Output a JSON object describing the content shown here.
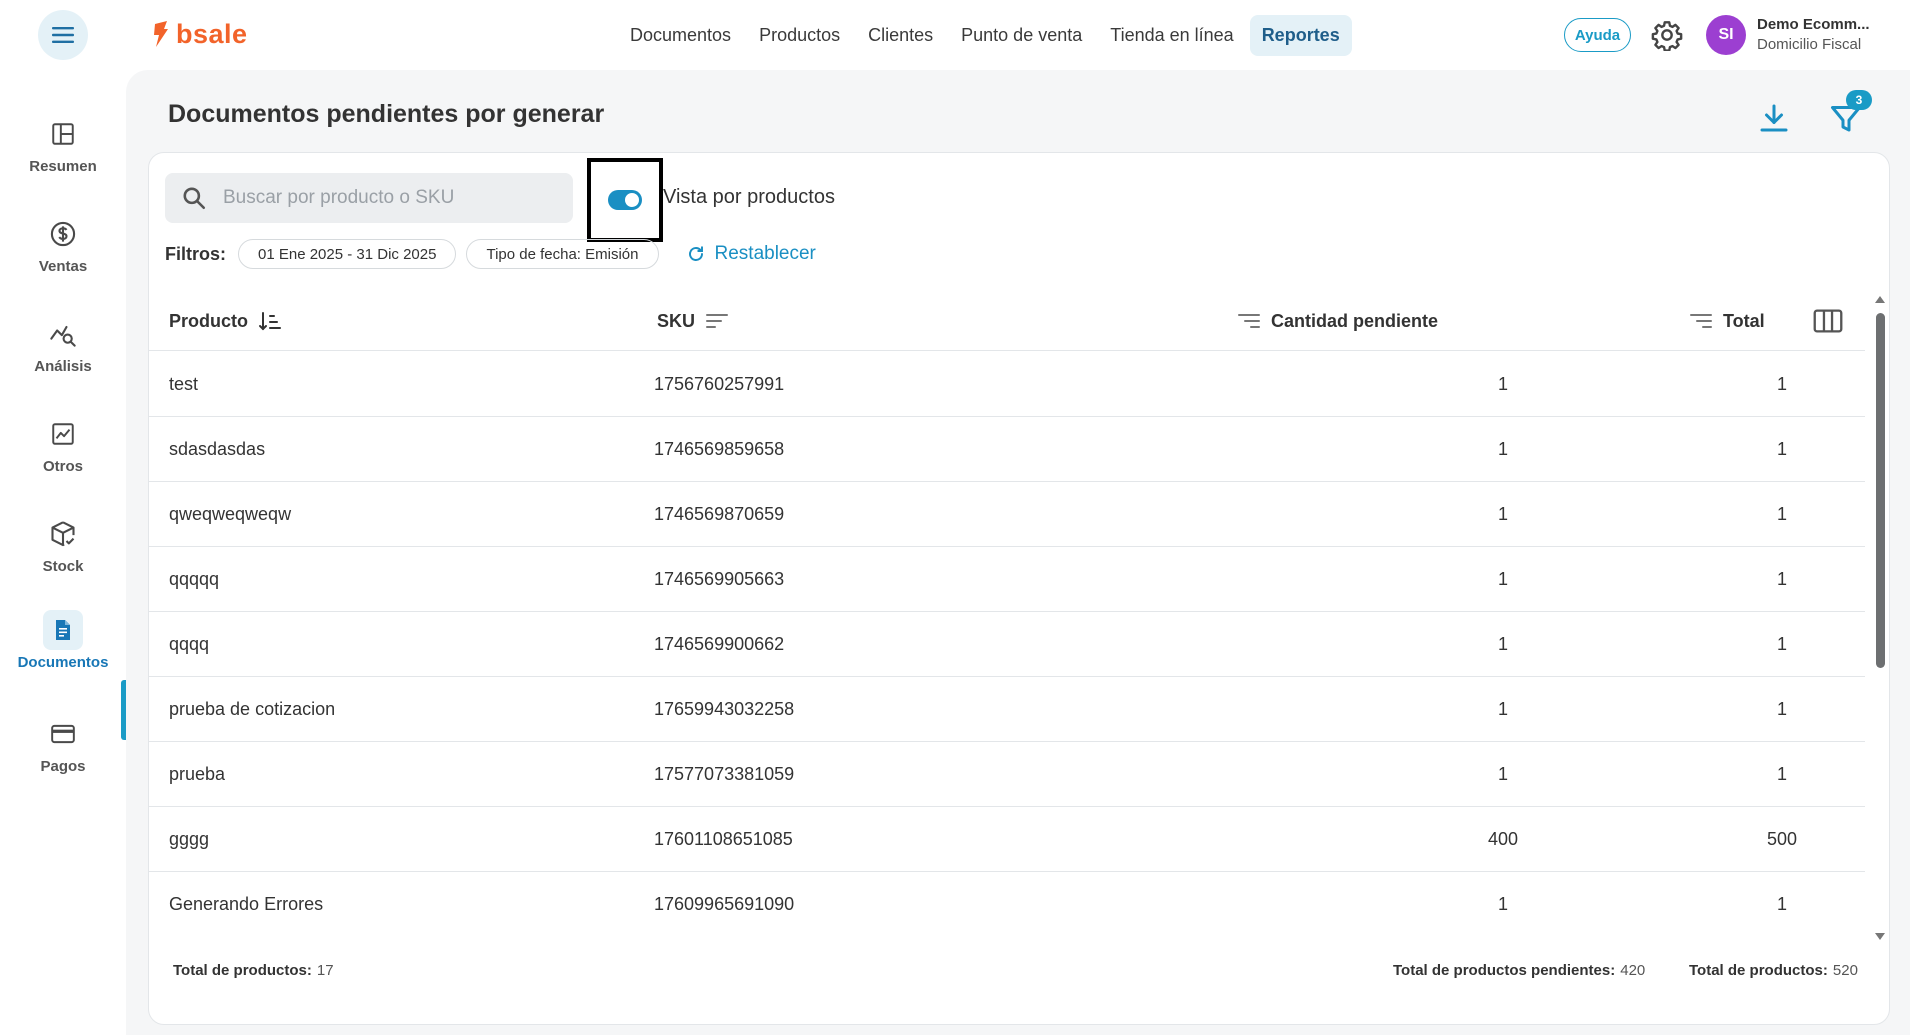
{
  "header": {
    "logo_text": "bsale",
    "nav": [
      "Documentos",
      "Productos",
      "Clientes",
      "Punto de venta",
      "Tienda en línea",
      "Reportes"
    ],
    "nav_active": "Reportes",
    "help_label": "Ayuda",
    "avatar_initials": "SI",
    "account_name": "Demo Ecomm...",
    "account_sub": "Domicilio Fiscal"
  },
  "sidebar": {
    "items": [
      {
        "label": "Resumen",
        "icon": "layout-icon"
      },
      {
        "label": "Ventas",
        "icon": "dollar-circle-icon"
      },
      {
        "label": "Análisis",
        "icon": "chart-search-icon"
      },
      {
        "label": "Otros",
        "icon": "trend-chart-icon"
      },
      {
        "label": "Stock",
        "icon": "box-check-icon"
      },
      {
        "label": "Documentos",
        "icon": "document-icon"
      },
      {
        "label": "Pagos",
        "icon": "credit-card-icon"
      }
    ],
    "active": "Documentos"
  },
  "page": {
    "title": "Documentos pendientes por generar",
    "filter_badge": "3"
  },
  "search": {
    "placeholder": "Buscar por producto o SKU",
    "value": ""
  },
  "toggle": {
    "label": "Vista por productos",
    "on": true
  },
  "filters": {
    "label": "Filtros:",
    "chips": [
      "01 Ene 2025 - 31 Dic 2025",
      "Tipo de fecha: Emisión"
    ],
    "reset_label": "Restablecer"
  },
  "table": {
    "columns": [
      "Producto",
      "SKU",
      "Cantidad pendiente",
      "Total"
    ],
    "rows": [
      {
        "producto": "test",
        "sku": "1756760257991",
        "cantidad": "1",
        "total": "1"
      },
      {
        "producto": "sdasdasdas",
        "sku": "1746569859658",
        "cantidad": "1",
        "total": "1"
      },
      {
        "producto": "qweqweqweqw",
        "sku": "1746569870659",
        "cantidad": "1",
        "total": "1"
      },
      {
        "producto": "qqqqq",
        "sku": "1746569905663",
        "cantidad": "1",
        "total": "1"
      },
      {
        "producto": "qqqq",
        "sku": "1746569900662",
        "cantidad": "1",
        "total": "1"
      },
      {
        "producto": "prueba de cotizacion",
        "sku": "17659943032258",
        "cantidad": "1",
        "total": "1"
      },
      {
        "producto": "prueba",
        "sku": "17577073381059",
        "cantidad": "1",
        "total": "1"
      },
      {
        "producto": "gggg",
        "sku": "17601108651085",
        "cantidad": "400",
        "total": "500"
      },
      {
        "producto": "Generando Errores",
        "sku": "17609965691090",
        "cantidad": "1",
        "total": "1"
      }
    ]
  },
  "footer": {
    "total_productos_label": "Total de productos:",
    "total_productos_value": "17",
    "pendientes_label": "Total de productos pendientes:",
    "pendientes_value": "420",
    "total_label": "Total de productos:",
    "total_value": "520"
  },
  "colors": {
    "accent": "#1a9bc6",
    "logo": "#f2632a",
    "avatar": "#9c3fd1"
  }
}
